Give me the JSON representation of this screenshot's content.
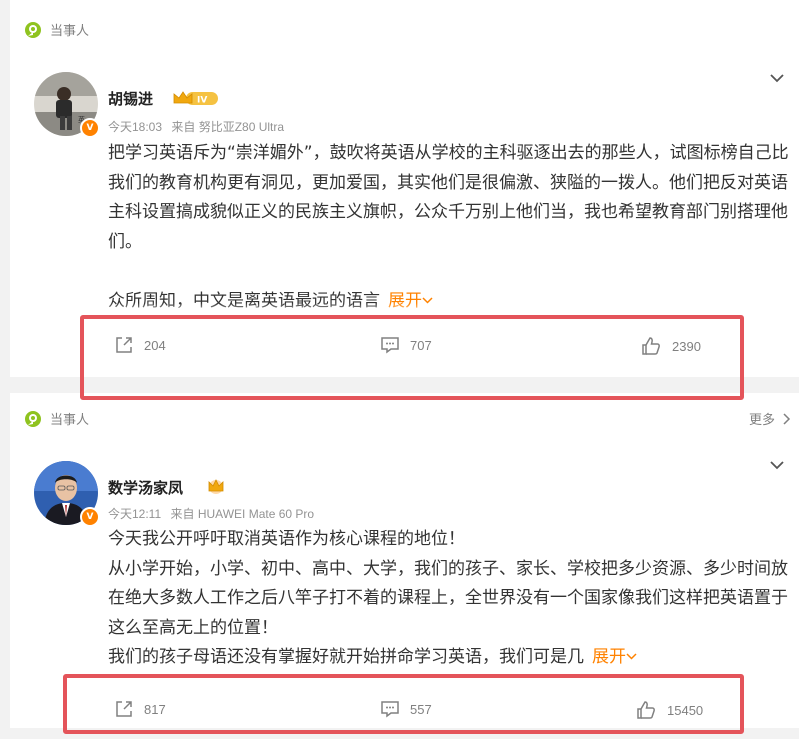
{
  "posts": [
    {
      "topic_label": "当事人",
      "username": "胡锡进",
      "level": "IV",
      "time": "今天18:03",
      "source": "来自 努比亚Z80 Ultra",
      "paragraphs": [
        "把学习英语斥为“崇洋媚外”，鼓吹将英语从学校的主科驱逐出去的那些人，试图标榜自己比我们的教育机构更有洞见，更加爱国，其实他们是很偏激、狭隘的一拨人。他们把反对英语主科设置搞成貌似正义的民族主义旗帜，公众千万别上他们当，我也希望教育部门别搭理他们。",
        "众所周知，中文是离英语最远的语言"
      ],
      "expand_label": "展开",
      "reposts": "204",
      "comments": "707",
      "likes": "2390"
    },
    {
      "topic_label": "当事人",
      "more_label": "更多",
      "username": "数学汤家凤",
      "time": "今天12:11",
      "source": "来自 HUAWEI Mate 60 Pro",
      "paragraphs": [
        "今天我公开呼吁取消英语作为核心课程的地位！",
        "从小学开始，小学、初中、高中、大学，我们的孩子、家长、学校把多少资源、多少时间放在绝大多数人工作之后八竿子打不着的课程上，全世界没有一个国家像我们这样把英语置于这么至高无上的位置！",
        "我们的孩子母语还没有掌握好就开始拼命学习英语，我们可是几"
      ],
      "expand_label": "展开",
      "reposts": "817",
      "comments": "557",
      "likes": "15450"
    }
  ],
  "colors": {
    "accent_orange": "#ff8200",
    "highlight_red": "#e4545a",
    "topic_green": "#8fc31f",
    "text_gray": "#939393"
  },
  "icons": [
    "topic-icon",
    "chevron-down-icon",
    "repost-icon",
    "comment-icon",
    "like-icon",
    "crown-icon",
    "verified-badge-icon",
    "chevron-right-icon"
  ]
}
